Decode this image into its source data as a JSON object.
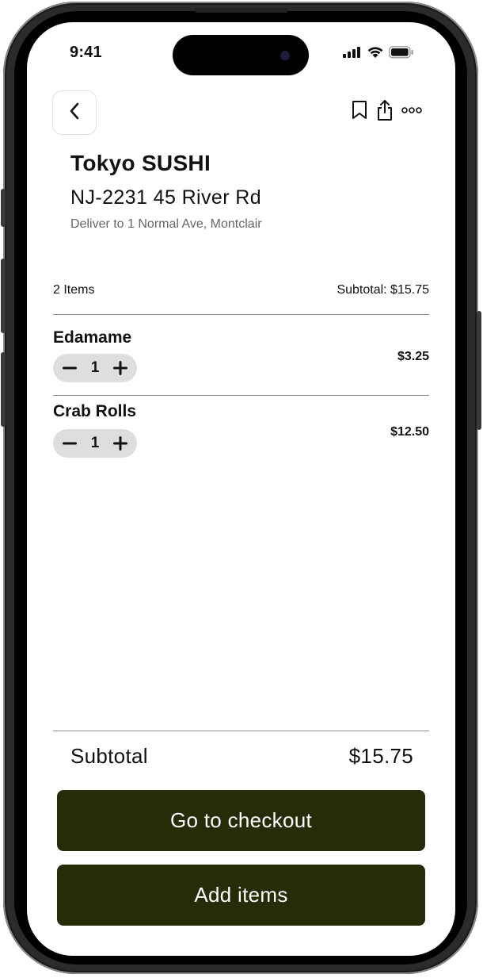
{
  "status_bar": {
    "time": "9:41",
    "icons": [
      "cellular-signal-icon",
      "wifi-icon",
      "battery-icon"
    ]
  },
  "nav": {
    "back_icon": "chevron-left-icon",
    "actions": [
      "bookmark-icon",
      "share-icon",
      "more-icon"
    ]
  },
  "restaurant": {
    "name": "Tokyo SUSHI",
    "address": "NJ-2231 45 River Rd",
    "delivery": "Deliver to 1 Normal Ave, Montclair"
  },
  "summary": {
    "count": "2 Items",
    "subtotal": "Subtotal: $15.75"
  },
  "items": [
    {
      "name": "Edamame",
      "quantity": "1",
      "price": "$3.25"
    },
    {
      "name": "Crab Rolls",
      "quantity": "1",
      "price": "$12.50"
    }
  ],
  "footer": {
    "subtotal_label": "Subtotal",
    "subtotal_value": "$15.75",
    "checkout_label": "Go to checkout",
    "add_items_label": "Add items"
  },
  "colors": {
    "button_bg": "#262c08",
    "stepper_bg": "#dedede",
    "divider": "#8f8f8f"
  }
}
